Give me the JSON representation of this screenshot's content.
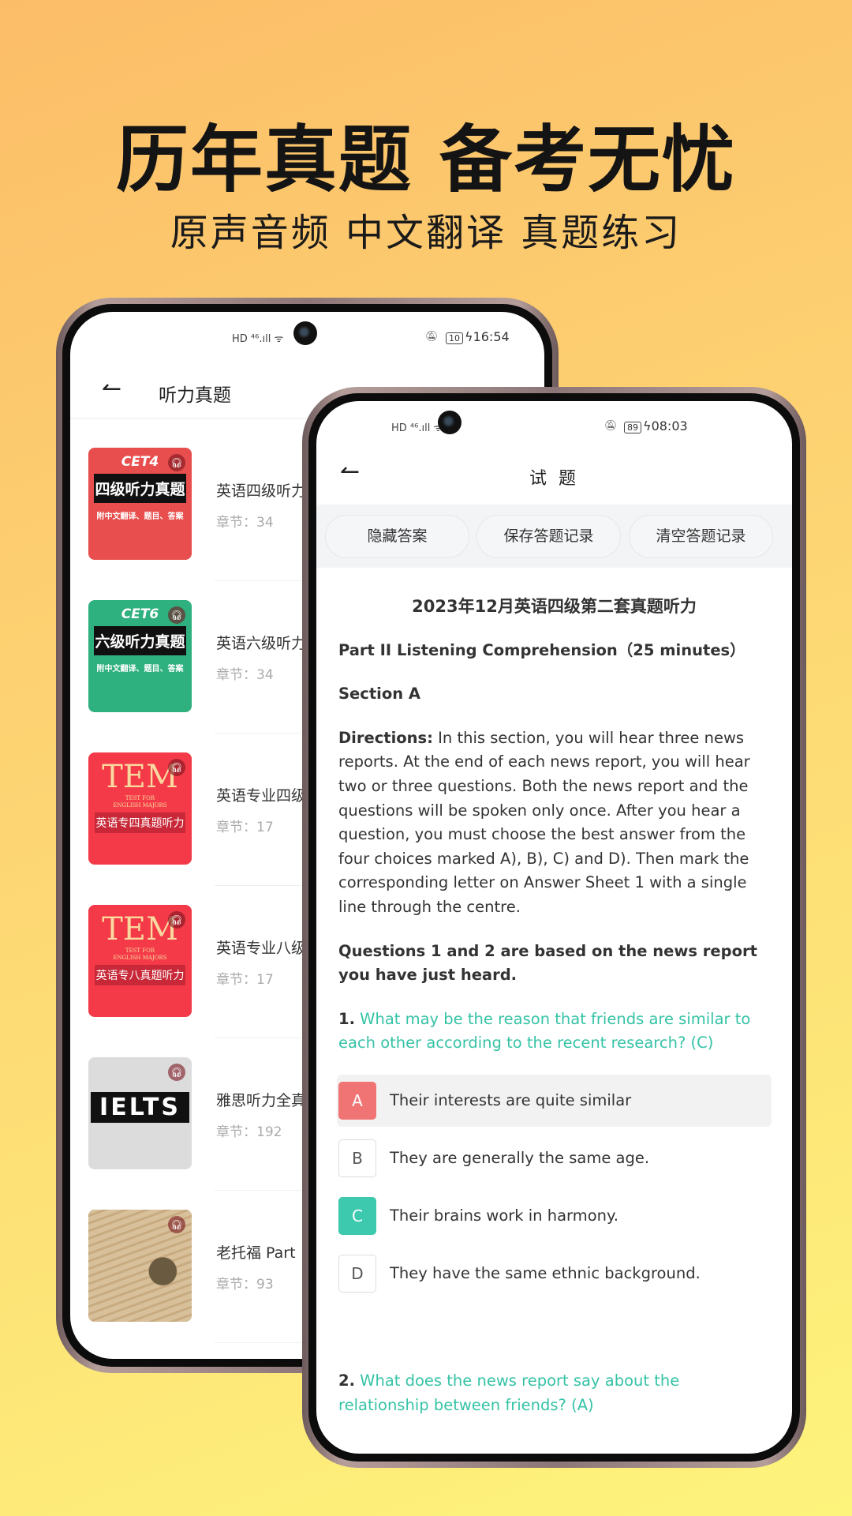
{
  "promo": {
    "headline": "历年真题 备考无忧",
    "subline": "原声音频 中文翻译 真题练习"
  },
  "left_phone": {
    "status": {
      "icons": "HD ⁴⁶.ıll ᯤ",
      "battery": "10",
      "time": "16:54"
    },
    "header": {
      "back_icon": "arrow-left",
      "title": "听力真题"
    },
    "chapter_label": "章节：",
    "items": [
      {
        "title": "英语四级听力",
        "chapters": "34",
        "cover_tag": "CET4",
        "cover_title": "四级听力真题",
        "cover_sub": "附中文翻译、题目、答案",
        "color": "#e84e4e"
      },
      {
        "title": "英语六级听力",
        "chapters": "34",
        "cover_tag": "CET6",
        "cover_title": "六级听力真题",
        "cover_sub": "附中文翻译、题目、答案",
        "color": "#2fb07f"
      },
      {
        "title": "英语专业四级",
        "chapters": "17",
        "cover_tag": "TEM",
        "cover_title": "TEST FOR ENGLISH MAJORS",
        "cover_sub": "英语专四真题听力",
        "color": "#f43a48"
      },
      {
        "title": "英语专业八级",
        "chapters": "17",
        "cover_tag": "TEM",
        "cover_title": "TEST FOR ENGLISH MAJORS",
        "cover_sub": "英语专八真题听力",
        "color": "#f43a48"
      },
      {
        "title": "雅思听力全真",
        "chapters": "192",
        "cover_tag": "IELTS",
        "cover_title": "",
        "cover_sub": "",
        "color": "#dcdcdc"
      },
      {
        "title": "老托福 Part",
        "chapters": "93",
        "cover_tag": "",
        "cover_title": "",
        "cover_sub": "",
        "color": "#b08a5c"
      }
    ]
  },
  "right_phone": {
    "status": {
      "icons": "HD ⁴⁶.ıll ᯤ",
      "battery": "89",
      "time": "08:03"
    },
    "header": {
      "back_icon": "arrow-left",
      "title": "试 题"
    },
    "toolbar": {
      "hide_answers": "隐藏答案",
      "save_record": "保存答题记录",
      "clear_record": "清空答题记录"
    },
    "exam_title": "2023年12月英语四级第二套真题听力",
    "part": "Part II Listening Comprehension（25 minutes）",
    "section": "Section A",
    "directions_label": "Directions:",
    "directions": " In this section, you will hear three news reports. At the end of each news report, you will hear two or three questions. Both the news report and the questions will be spoken only once. After you hear a question, you must choose the best answer from the four choices marked A), B), C) and D). Then mark the corresponding letter on Answer Sheet 1 with a single line through the centre.",
    "group_note": "Questions 1 and 2 are based on the news report you have just heard.",
    "questions": [
      {
        "number": "1.",
        "text": " What may be the reason that friends are similar to each other according to the recent research? (C)",
        "options": [
          {
            "letter": "A",
            "text": "Their interests are quite similar",
            "state": "wrong-selected"
          },
          {
            "letter": "B",
            "text": "They are generally the same age.",
            "state": "none"
          },
          {
            "letter": "C",
            "text": "Their brains work in harmony.",
            "state": "correct"
          },
          {
            "letter": "D",
            "text": "They have the same ethnic background.",
            "state": "none"
          }
        ]
      },
      {
        "number": "2.",
        "text": " What does the news report say about the relationship between friends? (A)"
      }
    ],
    "colors": {
      "accent": "#35c3a6",
      "wrong": "#f07474"
    }
  }
}
